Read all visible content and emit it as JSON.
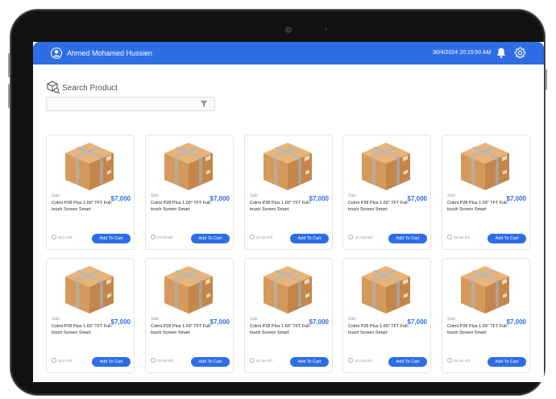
{
  "header": {
    "user_name": "Ahmed Mohamed Hussien",
    "datetime": "30/4/2024 20:15:50 AM",
    "bg_color": "#2e6de5"
  },
  "search": {
    "title": "Search Product",
    "value": ""
  },
  "products": [
    {
      "badge": "Sale",
      "price": "$7,000",
      "name": "Colmi P28 Plus 1.69\" TFT Full-touch Screen Smart",
      "stock": "35 in left",
      "add_label": "Add To Cart"
    },
    {
      "badge": "Sale",
      "price": "$7,000",
      "name": "Colmi P28 Plus 1.69\" TFT Full-touch Screen Smart",
      "stock": "33 left left",
      "add_label": "Add To Cart"
    },
    {
      "badge": "Sale",
      "price": "$7,000",
      "name": "Colmi P28 Plus 1.69\" TFT Full-touch Screen Smart",
      "stock": "21 are left",
      "add_label": "Add To Cart"
    },
    {
      "badge": "Sale",
      "price": "$7,000",
      "name": "Colmi P28 Plus 1.69\" TFT Full-touch Screen Smart",
      "stock": "12 total left",
      "add_label": "Add To Cart"
    },
    {
      "badge": "Sale",
      "price": "$7,000",
      "name": "Colmi P28 Plus 1.69\" TFT Full-touch Screen Smart",
      "stock": "35 are left",
      "add_label": "Add To Cart"
    },
    {
      "badge": "Sale",
      "price": "$7,000",
      "name": "Colmi P28 Plus 1.69\" TFT Full-touch Screen Smart",
      "stock": "35 in left",
      "add_label": "Add To Cart"
    },
    {
      "badge": "Sale",
      "price": "$7,000",
      "name": "Colmi P28 Plus 1.69\" TFT Full-touch Screen Smart",
      "stock": "33 left left",
      "add_label": "Add To Cart"
    },
    {
      "badge": "Sale",
      "price": "$7,000",
      "name": "Colmi P28 Plus 1.69\" TFT Full-touch Screen Smart",
      "stock": "21 are left",
      "add_label": "Add To Cart"
    },
    {
      "badge": "Sale",
      "price": "$7,000",
      "name": "Colmi P28 Plus 1.69\" TFT Full-touch Screen Smart",
      "stock": "12 total left",
      "add_label": "Add To Cart"
    },
    {
      "badge": "Sale",
      "price": "$7,000",
      "name": "Colmi P28 Plus 1.69\" TFT Full-touch Screen Smart",
      "stock": "35 are left",
      "add_label": "Add To Cart"
    }
  ],
  "icons": {
    "user": "user-avatar-icon",
    "bell": "bell-icon",
    "gear": "gear-icon",
    "search_title": "box-search-icon",
    "filter": "filter-icon",
    "product": "cardboard-box-icon"
  }
}
